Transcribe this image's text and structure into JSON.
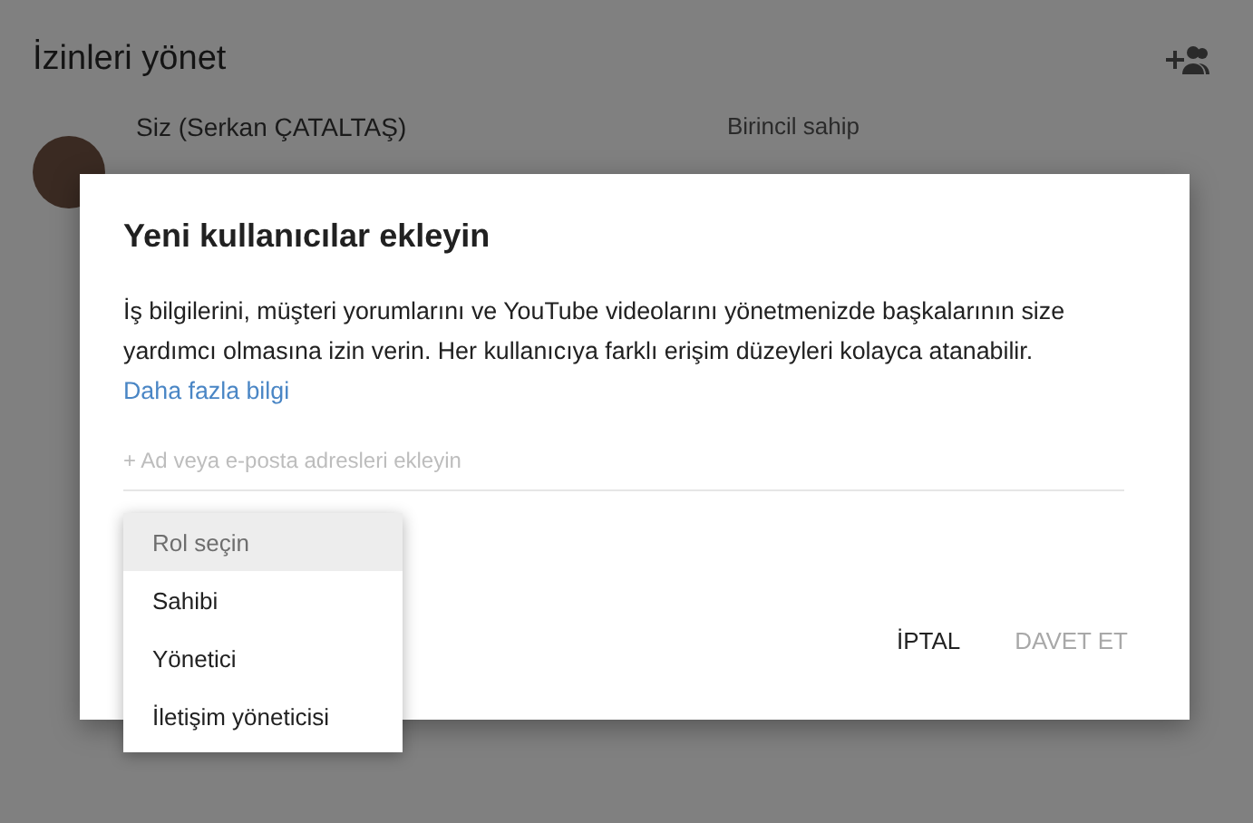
{
  "page": {
    "title": "İzinleri yönet",
    "users": [
      {
        "name": "Siz (Serkan ÇATALTAŞ)",
        "role": "Birincil sahip"
      }
    ]
  },
  "dialog": {
    "title": "Yeni kullanıcılar ekleyin",
    "description": "İş bilgilerini, müşteri yorumlarını ve YouTube videolarını yönetmenizde başkalarının size yardımcı olmasına izin verin. Her kullanıcıya farklı erişim düzeyleri kolayca atanabilir.",
    "link": "Daha fazla bilgi",
    "field": {
      "placeholder": "+ Ad veya e-posta adresleri ekleyin"
    },
    "buttons": [
      {
        "label": "İPTAL",
        "disabled": false
      },
      {
        "label": "DAVET ET",
        "disabled": true
      }
    ]
  },
  "role_menu": [
    {
      "label": "Rol seçin",
      "selected": true
    },
    {
      "label": "Sahibi",
      "selected": false
    },
    {
      "label": "Yönetici",
      "selected": false
    },
    {
      "label": "İletişim yöneticisi",
      "selected": false
    }
  ]
}
